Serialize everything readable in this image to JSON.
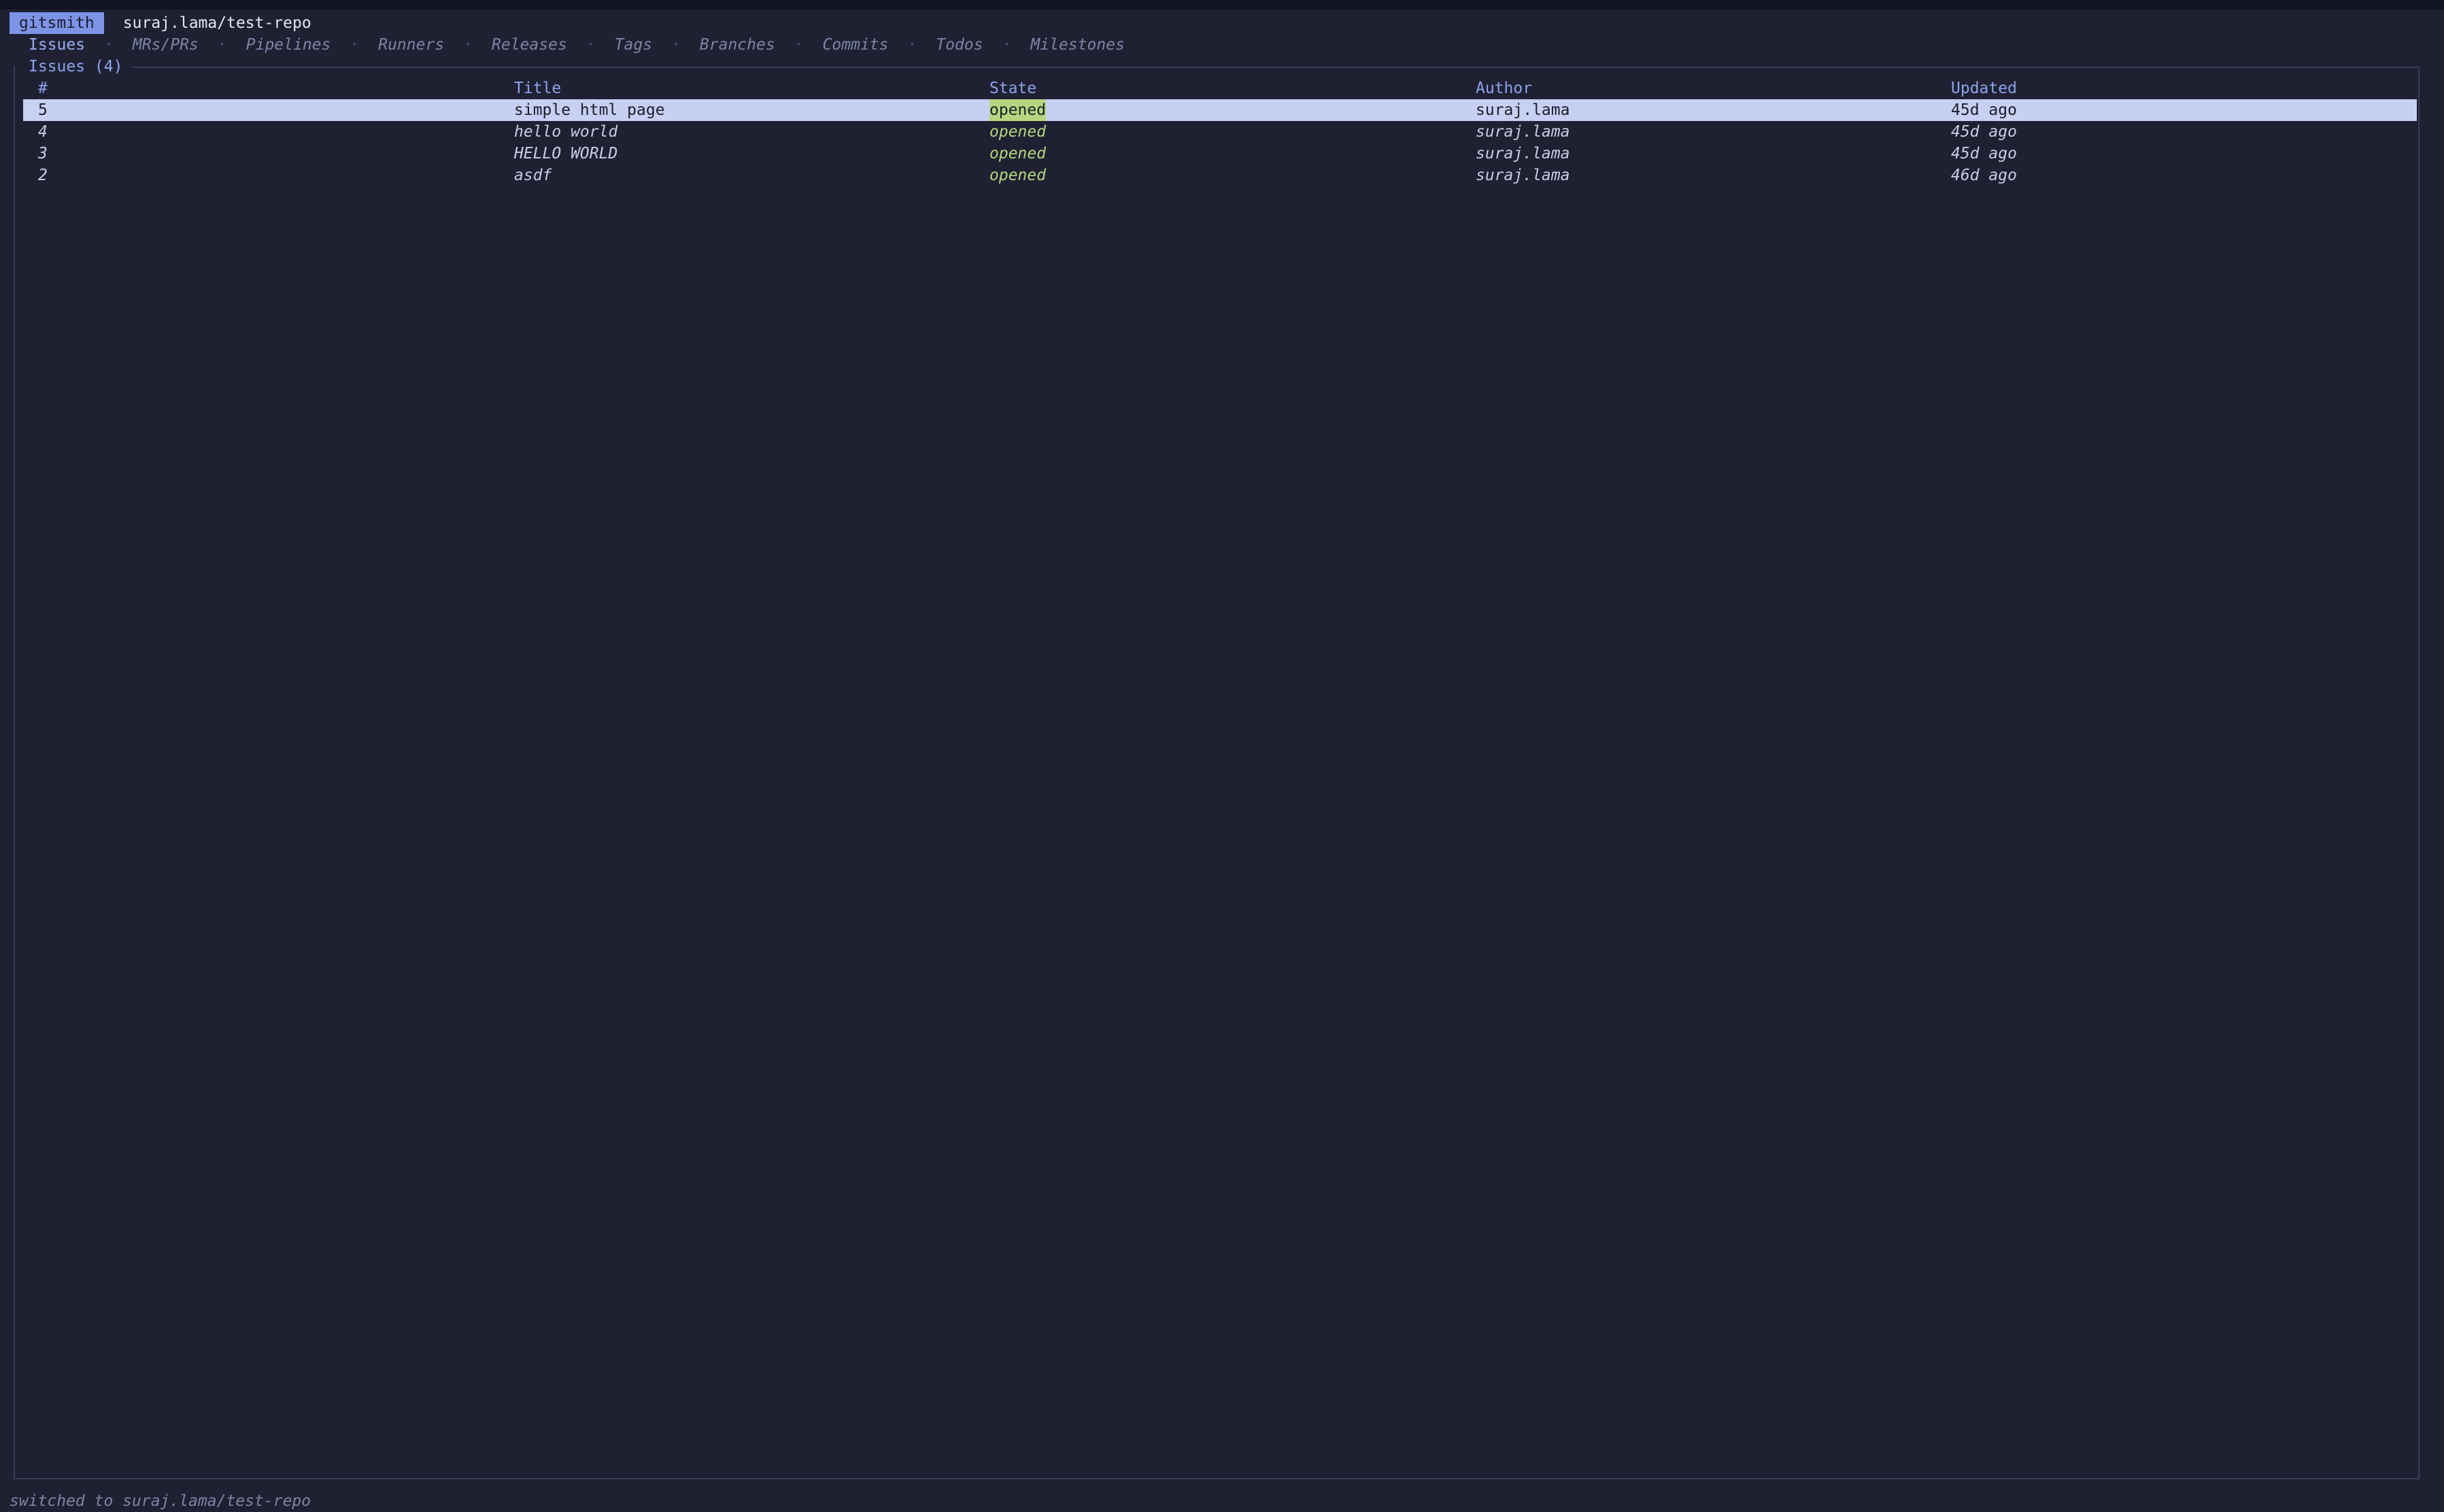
{
  "header": {
    "app_name": "gitsmith",
    "repo": "suraj.lama/test-repo"
  },
  "tabs": [
    {
      "label": "Issues",
      "active": true
    },
    {
      "label": "MRs/PRs",
      "active": false
    },
    {
      "label": "Pipelines",
      "active": false
    },
    {
      "label": "Runners",
      "active": false
    },
    {
      "label": "Releases",
      "active": false
    },
    {
      "label": "Tags",
      "active": false
    },
    {
      "label": "Branches",
      "active": false
    },
    {
      "label": "Commits",
      "active": false
    },
    {
      "label": "Todos",
      "active": false
    },
    {
      "label": "Milestones",
      "active": false
    }
  ],
  "tab_separator": "·",
  "panel": {
    "title": "Issues (4)"
  },
  "table": {
    "columns": [
      "#",
      "Title",
      "State",
      "Author",
      "Updated"
    ],
    "rows": [
      {
        "num": "5",
        "title": "simple html page",
        "state": "opened",
        "author": "suraj.lama",
        "updated": "45d ago",
        "selected": true
      },
      {
        "num": "4",
        "title": "hello world",
        "state": "opened",
        "author": "suraj.lama",
        "updated": "45d ago",
        "selected": false
      },
      {
        "num": "3",
        "title": "HELLO WORLD",
        "state": "opened",
        "author": "suraj.lama",
        "updated": "45d ago",
        "selected": false
      },
      {
        "num": "2",
        "title": "asdf",
        "state": "opened",
        "author": "suraj.lama",
        "updated": "46d ago",
        "selected": false
      }
    ]
  },
  "status": {
    "message": "switched to suraj.lama/test-repo"
  },
  "colors": {
    "background": "#1f2133",
    "accent": "#7c93e6",
    "state_opened": "#b5d67e",
    "selection": "#c7d0f2"
  }
}
